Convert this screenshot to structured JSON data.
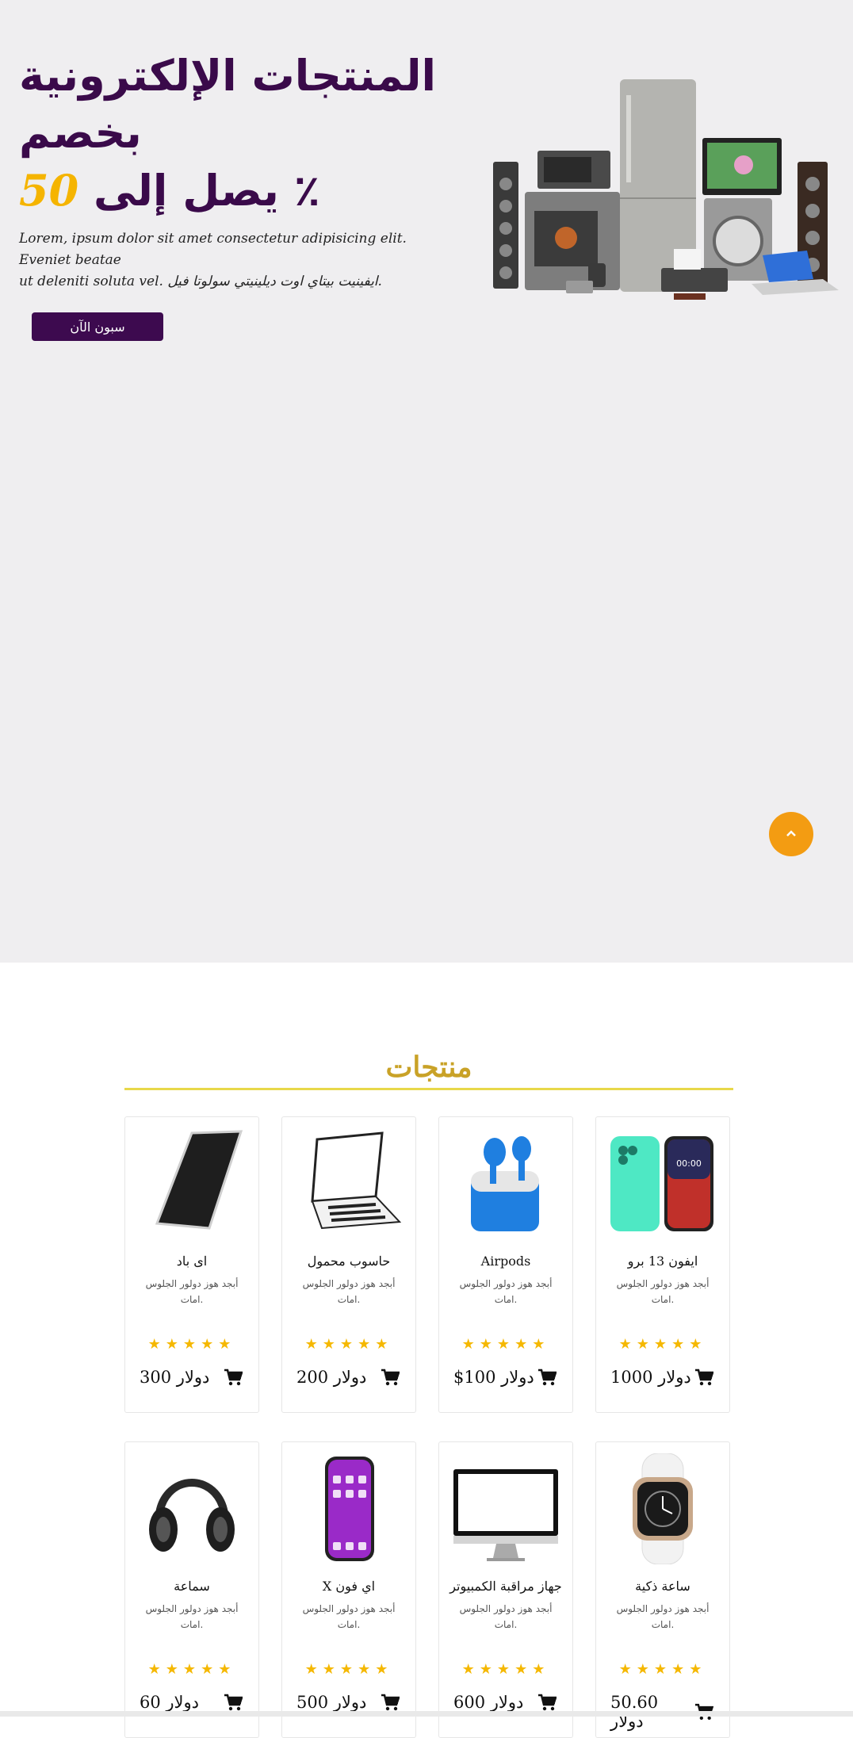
{
  "hero": {
    "title_line1": "المنتجات الإلكترونية",
    "title_line2": "بخصم",
    "title_line3_text": "يصل إلى",
    "title_line3_number": "50",
    "title_line3_percent": "٪",
    "description_line1": "Lorem, ipsum dolor sit amet consectetur adipisicing elit. Eveniet beatae",
    "description_line2": "ut deleniti soluta vel. ايفينيت بيتاي اوت ديلينيتي سولوتا فيل.",
    "button_label": "سبون الآن",
    "image_icon": "home-appliances-image"
  },
  "scroll_top": {
    "icon": "chevron-up-icon"
  },
  "products_section": {
    "title": "منتجات",
    "rating_stars": "★★★★★",
    "products": [
      {
        "name": "ايفون 13 برو",
        "desc": "أبجد هوز دولور الجلوس امات.",
        "price": "1000 دولار",
        "icon": "iphone-13-pro-image"
      },
      {
        "name": "Airpods",
        "desc": "أبجد هوز دولور الجلوس امات.",
        "price": "$100 دولار",
        "icon": "airpods-image"
      },
      {
        "name": "حاسوب محمول",
        "desc": "أبجد هوز دولور الجلوس امات.",
        "price": "200 دولار",
        "icon": "laptop-image"
      },
      {
        "name": "اى باد",
        "desc": "أبجد هوز دولور الجلوس امات.",
        "price": "300 دولار",
        "icon": "ipad-image"
      },
      {
        "name": "ساعة ذكية",
        "desc": "أبجد هوز دولور الجلوس امات.",
        "price": "50.60 دولار",
        "icon": "smartwatch-image"
      },
      {
        "name": "جهاز مراقبة الكمبيوتر",
        "desc": "أبجد هوز دولور الجلوس امات.",
        "price": "600 دولار",
        "icon": "monitor-image"
      },
      {
        "name": "X اي فون",
        "desc": "أبجد هوز دولور الجلوس امات.",
        "price": "500 دولار",
        "icon": "iphone-x-image"
      },
      {
        "name": "سماعة",
        "desc": "أبجد هوز دولور الجلوس امات.",
        "price": "60 دولار",
        "icon": "headphones-image"
      }
    ]
  },
  "colors": {
    "hero_bg": "#efeef0",
    "title_purple": "#3a0a4a",
    "accent_yellow": "#f5b400",
    "button_purple": "#3d0a4f",
    "scroll_orange": "#f39c12",
    "section_gold": "#c9a227"
  }
}
